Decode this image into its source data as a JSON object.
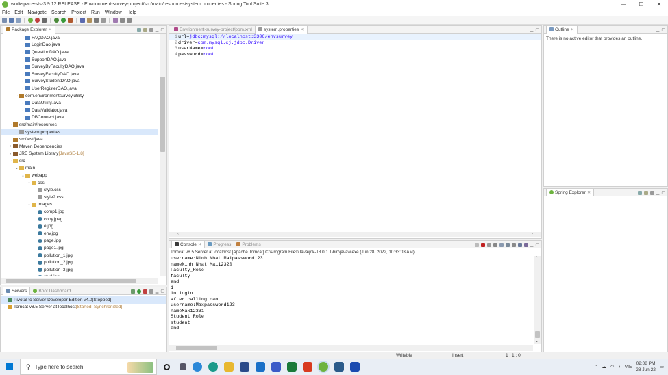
{
  "window": {
    "title": "workspace-sts-3.9.12.RELEASE - Envrionment-survey-project/src/main/resources/system.properties - Spring Tool Suite 3",
    "min": "—",
    "max": "☐",
    "close": "✕"
  },
  "menu": [
    "File",
    "Edit",
    "Navigate",
    "Search",
    "Project",
    "Run",
    "Window",
    "Help"
  ],
  "package_explorer": {
    "tab": "Package Explorer",
    "tab_suffix": "⨯",
    "items": [
      {
        "label": "FAQDAO.java",
        "indent": 3,
        "arrow": "›",
        "icon": "java"
      },
      {
        "label": "LoginDao.java",
        "indent": 3,
        "arrow": "›",
        "icon": "java"
      },
      {
        "label": "QuestionDAO.java",
        "indent": 3,
        "arrow": "›",
        "icon": "java"
      },
      {
        "label": "SupportDAO.java",
        "indent": 3,
        "arrow": "›",
        "icon": "java"
      },
      {
        "label": "SurveyByFacultyDAO.java",
        "indent": 3,
        "arrow": "›",
        "icon": "java"
      },
      {
        "label": "SurveyFacultyDAO.java",
        "indent": 3,
        "arrow": "›",
        "icon": "java"
      },
      {
        "label": "SurveyStudentDAO.java",
        "indent": 3,
        "arrow": "›",
        "icon": "java"
      },
      {
        "label": "UserRegisterDAO.java",
        "indent": 3,
        "arrow": "›",
        "icon": "java"
      },
      {
        "label": "com.environmentsurvey.utility",
        "indent": 2,
        "arrow": "⌄",
        "icon": "package"
      },
      {
        "label": "DataUtility.java",
        "indent": 3,
        "arrow": "›",
        "icon": "java"
      },
      {
        "label": "DataValidator.java",
        "indent": 3,
        "arrow": "›",
        "icon": "java"
      },
      {
        "label": "DBConnect.java",
        "indent": 3,
        "arrow": "›",
        "icon": "java"
      },
      {
        "label": "src/main/resources",
        "indent": 1,
        "arrow": "⌄",
        "icon": "srcfolder"
      },
      {
        "label": "system.properties",
        "indent": 2,
        "arrow": "",
        "icon": "file",
        "selected": true
      },
      {
        "label": "src/test/java",
        "indent": 1,
        "arrow": "",
        "icon": "srcfolder"
      },
      {
        "label": "Maven Dependencies",
        "indent": 1,
        "arrow": "›",
        "icon": "library"
      },
      {
        "label": "JRE System Library",
        "suffix": " [JavaSE-1.8]",
        "indent": 1,
        "arrow": "›",
        "icon": "library"
      },
      {
        "label": "src",
        "indent": 1,
        "arrow": "⌄",
        "icon": "folder"
      },
      {
        "label": "main",
        "indent": 2,
        "arrow": "⌄",
        "icon": "folder"
      },
      {
        "label": "webapp",
        "indent": 3,
        "arrow": "⌄",
        "icon": "folder"
      },
      {
        "label": "css",
        "indent": 4,
        "arrow": "⌄",
        "icon": "folder"
      },
      {
        "label": "style.css",
        "indent": 5,
        "arrow": "",
        "icon": "file"
      },
      {
        "label": "style2.css",
        "indent": 5,
        "arrow": "",
        "icon": "file"
      },
      {
        "label": "images",
        "indent": 4,
        "arrow": "⌄",
        "icon": "folder"
      },
      {
        "label": "comp1.jpg",
        "indent": 5,
        "arrow": "",
        "icon": "image"
      },
      {
        "label": "copy.jpeg",
        "indent": 5,
        "arrow": "",
        "icon": "image"
      },
      {
        "label": "e.jpg",
        "indent": 5,
        "arrow": "",
        "icon": "image"
      },
      {
        "label": "env.jpg",
        "indent": 5,
        "arrow": "",
        "icon": "image"
      },
      {
        "label": "page.jpg",
        "indent": 5,
        "arrow": "",
        "icon": "image"
      },
      {
        "label": "page1.jpg",
        "indent": 5,
        "arrow": "",
        "icon": "image"
      },
      {
        "label": "pollution_1.jpg",
        "indent": 5,
        "arrow": "",
        "icon": "image"
      },
      {
        "label": "pollution_2.jpg",
        "indent": 5,
        "arrow": "",
        "icon": "image"
      },
      {
        "label": "pollution_3.jpg",
        "indent": 5,
        "arrow": "",
        "icon": "image"
      },
      {
        "label": "stud.jpg",
        "indent": 5,
        "arrow": "",
        "icon": "image"
      }
    ]
  },
  "servers": {
    "tab": "Servers",
    "tab2": "Boot Dashboard",
    "items": [
      {
        "label": "Pivotal tc Server Developer Edition v4.0",
        "status": "  [Stopped]",
        "selected": true
      },
      {
        "label": "Tomcat v8.5 Server at localhost",
        "status": "  [Started, Synchronized]",
        "selected": false
      }
    ]
  },
  "editor": {
    "tabs": [
      {
        "label": "Envrionment-survey-project/pom.xml",
        "active": false
      },
      {
        "label": "system.properties",
        "active": true
      }
    ],
    "lines": [
      {
        "num": "1",
        "key": "url",
        "eq": "=",
        "value": "jdbc:mysql://localhost:3306/envsurvey"
      },
      {
        "num": "2",
        "key": "driver",
        "eq": "=",
        "value": "com.mysql.cj.jdbc.Driver"
      },
      {
        "num": "3",
        "key": "userName",
        "eq": "=",
        "value": "root"
      },
      {
        "num": "4",
        "key": "password",
        "eq": "=",
        "value": "root"
      }
    ]
  },
  "outline": {
    "tab": "Outline",
    "message": "There is no active editor that provides an outline."
  },
  "spring_explorer": {
    "tab": "Spring Explorer"
  },
  "console": {
    "tabs": [
      "Console",
      "Progress",
      "Problems"
    ],
    "description": "Tomcat v8.5 Server at localhost [Apache Tomcat] C:\\Program Files\\Java\\jdk-18.0.1.1\\bin\\javaw.exe  (Jun 28, 2022, 10:33:03 AM)",
    "lines": [
      "username:Ninh Nhat Maipassword123",
      "nameNinh Nhat Mai12320",
      "Faculty_Role",
      "faculty",
      "end",
      "1",
      "in login",
      "after calling dao",
      "username:Maxpassword123",
      "nameMax12331",
      "Student_Role",
      "student",
      "end"
    ]
  },
  "status": {
    "writable": "Writable",
    "insert": "Insert",
    "position": "1 : 1 : 0"
  },
  "taskbar": {
    "search_placeholder": "Type here to search",
    "time": "02:08 PM",
    "date": "28 Jun 22",
    "lang": "VIE"
  },
  "colors": {
    "java_icon": "#4a7bbd",
    "package_icon": "#b07a2c",
    "folder_icon": "#e0b54a",
    "image_icon": "#3c7a9e",
    "file_icon": "#9a9a9a",
    "library_icon": "#8a5a2c",
    "sts_green": "#6db33f"
  }
}
